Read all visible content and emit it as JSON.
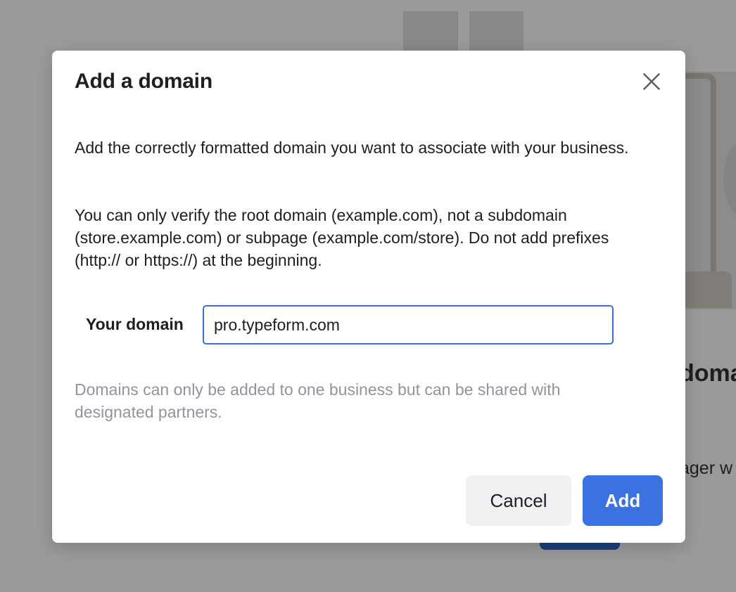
{
  "background": {
    "heading_fragment": "doma",
    "text_fragment": "ager w"
  },
  "modal": {
    "title": "Add a domain",
    "close_icon": "close-icon",
    "paragraph_1": "Add the correctly formatted domain you want to associate with your business.",
    "paragraph_2": "You can only verify the root domain (example.com), not a subdomain (store.example.com) or subpage (example.com/store). Do not add prefixes (http:// or https://) at the beginning.",
    "domain_label": "Your domain",
    "domain_value": "pro.typeform.com",
    "hint": "Domains can only be added to one business but can be shared with designated partners.",
    "cancel_label": "Cancel",
    "add_label": "Add"
  },
  "colors": {
    "primary": "#3a72e2",
    "input_border": "#3b6fd8",
    "hint_text": "#8f959c",
    "overlay": "#9a9a9a"
  }
}
